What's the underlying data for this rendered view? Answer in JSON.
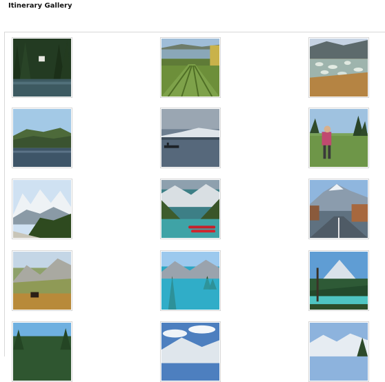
{
  "page": {
    "title": "Itinerary Gallery"
  },
  "gallery": {
    "items": [
      {
        "subject": "forest-cabin-lake"
      },
      {
        "subject": "vineyard-lake"
      },
      {
        "subject": "spotted-lake"
      },
      {
        "subject": "calm-lake-hills"
      },
      {
        "subject": "boat-dock-lake"
      },
      {
        "subject": "hiker-trail"
      },
      {
        "subject": "snowy-peaks-forest"
      },
      {
        "subject": "lake-louise-canoes"
      },
      {
        "subject": "mountain-town-road"
      },
      {
        "subject": "moose-valley"
      },
      {
        "subject": "turquoise-lake-island"
      },
      {
        "subject": "river-peak-pine"
      },
      {
        "subject": "forest-sky"
      },
      {
        "subject": "cloudy-snow-peaks"
      },
      {
        "subject": "blue-sky-range"
      }
    ]
  }
}
